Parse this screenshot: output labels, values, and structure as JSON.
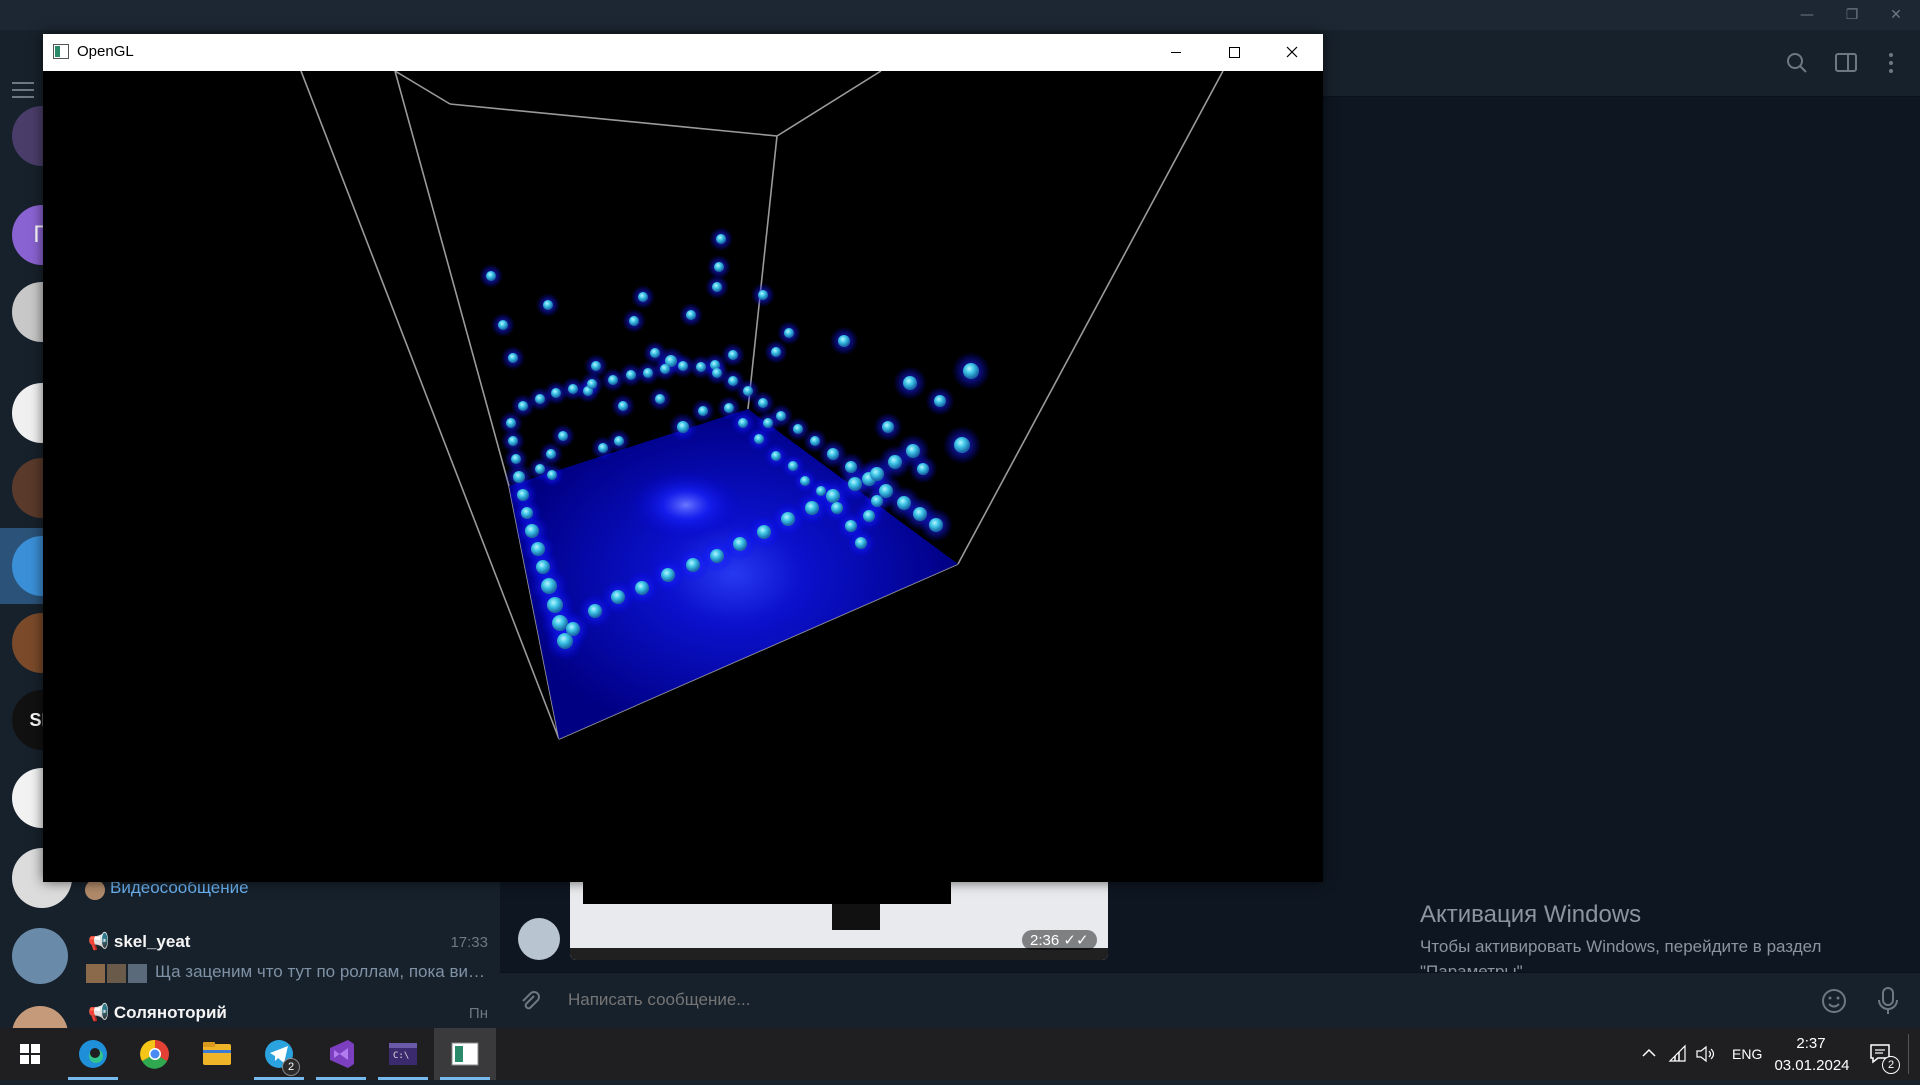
{
  "telegram": {
    "window_controls": {
      "minimize": "—",
      "restore": "❐",
      "close": "✕"
    },
    "chats": [
      {
        "name": "skel_yeat",
        "time": "17:33",
        "preview": "Ща заценим что тут по роллам, пока виж..."
      },
      {
        "name": "Соляноторий",
        "time": "Пн",
        "preview": ""
      }
    ],
    "partial_preview": "Видеосообщение",
    "folder_badges": {
      "p_letter": "П",
      "sn_letters": "SN"
    },
    "message": {
      "duration": "2:36"
    },
    "composer": {
      "placeholder": "Написать сообщение..."
    },
    "header_icons": [
      "search-icon",
      "sidebar-toggle-icon",
      "more-vertical-icon"
    ]
  },
  "activation": {
    "title": "Активация Windows",
    "text": "Чтобы активировать Windows, перейдите в раздел \"Параметры\"."
  },
  "opengl_window": {
    "title": "OpenGL",
    "controls": {
      "minimize": "minimize",
      "maximize": "maximize",
      "close": "close"
    },
    "colors": {
      "background": "#000000",
      "box_edges": "#9a9a9a",
      "particles": "#3fb8d6",
      "floor_glow": "#0000ff"
    }
  },
  "taskbar": {
    "apps": [
      "start-icon",
      "edge-icon",
      "chrome-icon",
      "file-explorer-icon",
      "telegram-icon",
      "visual-studio-icon",
      "console-icon",
      "opengl-app-icon"
    ],
    "telegram_badge": "2",
    "tray": {
      "language": "ENG",
      "time": "2:37",
      "date": "03.01.2024",
      "notification_count": "2"
    }
  }
}
